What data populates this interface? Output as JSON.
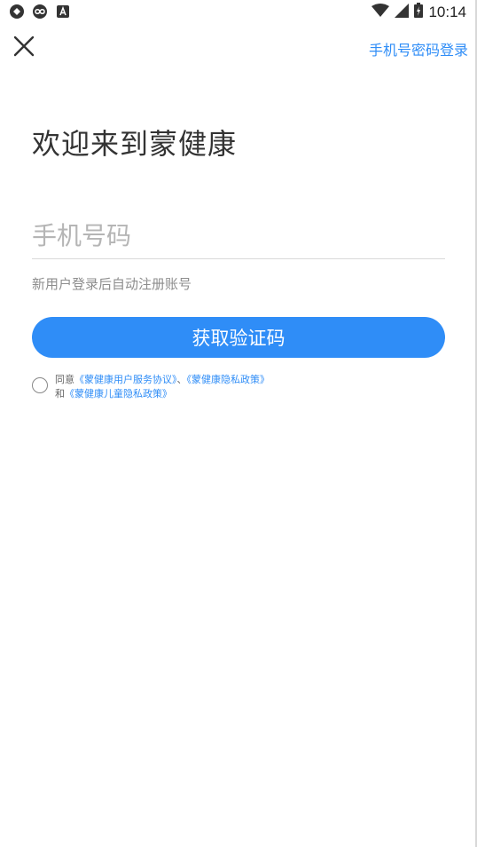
{
  "status_bar": {
    "icons": [
      "sync-icon",
      "loop-icon",
      "text-a-icon"
    ],
    "time": "10:14"
  },
  "header": {
    "close_icon": "close-icon",
    "password_login_label": "手机号密码登录"
  },
  "welcome_title": "欢迎来到蒙健康",
  "phone_input": {
    "placeholder": "手机号码",
    "value": ""
  },
  "hint_text": "新用户登录后自动注册账号",
  "get_code_button": "获取验证码",
  "agreement": {
    "prefix": "同意",
    "service_agreement": "《蒙健康用户服务协议》",
    "separator": "、",
    "privacy_policy": "《蒙健康隐私政策》",
    "conjunction": "和",
    "children_privacy_policy": "《蒙健康儿童隐私政策》",
    "checked": false
  },
  "colors": {
    "accent": "#2f8df7",
    "title_text": "#333333",
    "hint_text": "#8d8d8d",
    "placeholder": "#b5b5b5"
  }
}
